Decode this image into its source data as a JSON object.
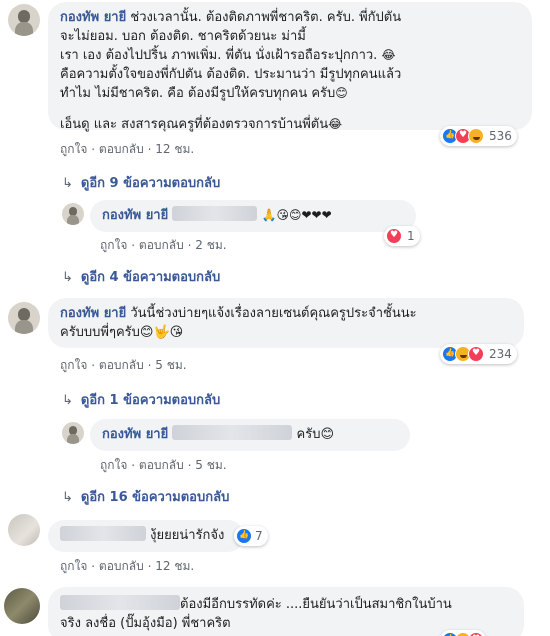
{
  "c1": {
    "author": "กองทัพ ยายี",
    "text_line1": " ช่วงเวลานั้น. ต้องติดภาพพี่ชาคริต. ครับ. พี่กัปตัน",
    "text_line2": "จะไม่ยอม. บอก ต้องติด. ชาคริตด้วยนะ ม่ามี้",
    "text_line3": "เรา เอง ต้องไปปริ้น ภาพเพิ่ม. พี่ตัน นั่งเฝ้ารอถือระปุกกาว. ",
    "text_line4": "คือความตั้งใจของพี่กัปตัน ต้องติด. ประมานว่า มีรูปทุกคนแล้ว",
    "text_line5": "ทำไม ไม่มีชาคริต. คือ ต้องมีรูปให้ครบทุกคน ครับ",
    "text_line6": "เอ็นดู และ สงสารคุณครูที่ต้องตรวจการบ้านพี่ตัน",
    "reaction_count": "536",
    "like": "ถูกใจ",
    "reply": "ตอบกลับ",
    "time": "12 ชม.",
    "view_replies": "ดูอีก 9 ข้อความตอบกลับ"
  },
  "r1": {
    "author": "กองทัพ ยายี",
    "emojis": "🙏😘😊❤❤❤",
    "reaction_count": "1",
    "like": "ถูกใจ",
    "reply": "ตอบกลับ",
    "time": "2 ชม.",
    "view_replies": "ดูอีก 4 ข้อความตอบกลับ"
  },
  "c2": {
    "author": "กองทัพ ยายี",
    "text_line1": " วันนี้ช่วงบ่ายๆแจ้งเรื่องลายเซนต์คุณครูประจำชั้นนะ",
    "text_line2": "ครับบบพี่ๆครับ😊🤟😘",
    "reaction_count": "234",
    "like": "ถูกใจ",
    "reply": "ตอบกลับ",
    "time": "5 ชม.",
    "view_replies": "ดูอีก 1 ข้อความตอบกลับ"
  },
  "r2": {
    "author": "กองทัพ ยายี",
    "text": "ครับ😊",
    "like": "ถูกใจ",
    "reply": "ตอบกลับ",
    "time": "5 ชม.",
    "view_replies": "ดูอีก 16 ข้อความตอบกลับ"
  },
  "c3": {
    "text": "งุ้ยยยน่ารักจัง",
    "reaction_count": "7",
    "like": "ถูกใจ",
    "reply": "ตอบกลับ",
    "time": "12 ชม."
  },
  "c4": {
    "text_line1": "ต้องมีอีกบรรทัดค่ะ ....ยืนยันว่าเป็นสมาชิกในบ้าน",
    "text_line2": "จริง ลงชื่อ (ปั๊มอุ้งมือ) พี่ชาคริต"
  },
  "sep": "·",
  "arrow": "↳"
}
